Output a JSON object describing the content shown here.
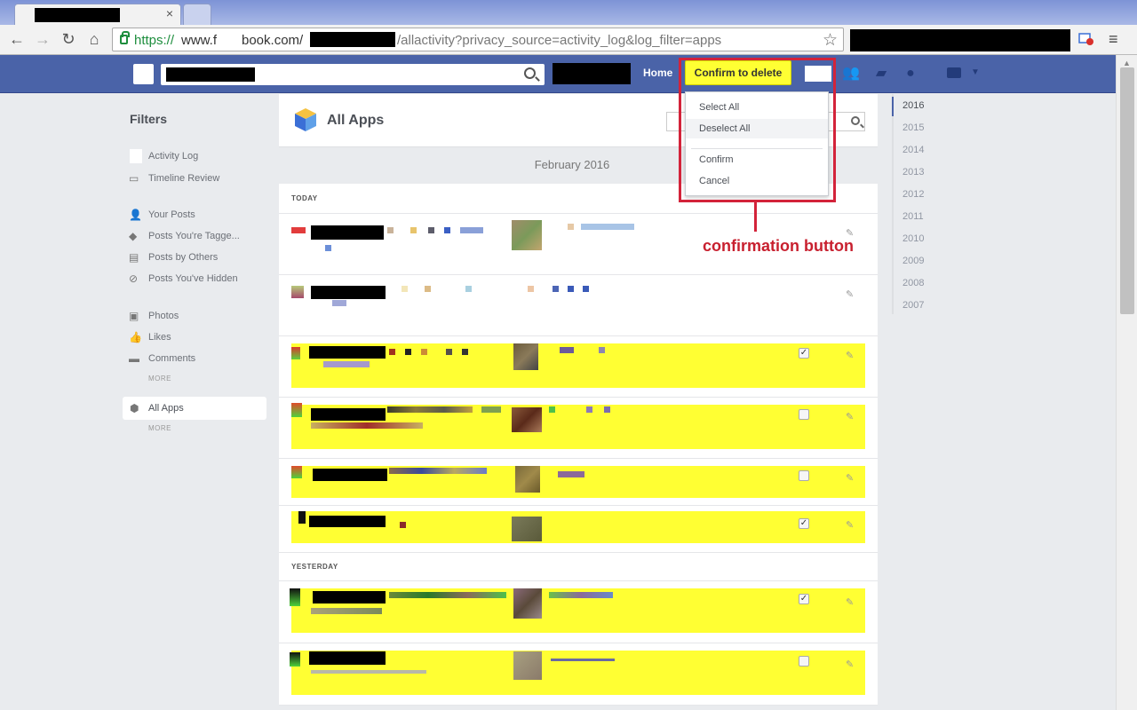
{
  "browser": {
    "url_scheme": "https://",
    "url_host_start": "www.f",
    "url_host_end": "book.com/",
    "url_path": "/allactivity?privacy_source=activity_log&log_filter=apps",
    "tab_close": "×"
  },
  "fb_header": {
    "home_label": "Home",
    "confirm_delete_label": "Confirm to delete"
  },
  "dropdown": {
    "items": [
      "Select All",
      "Deselect All",
      "Confirm",
      "Cancel"
    ]
  },
  "annotation": {
    "label": "confirmation button",
    "color": "#d3233a"
  },
  "filters": {
    "title": "Filters",
    "items": [
      "Activity Log",
      "Timeline Review",
      "Your Posts",
      "Posts You're Tagge...",
      "Posts by Others",
      "Posts You've Hidden",
      "Photos",
      "Likes",
      "Comments",
      "All Apps"
    ],
    "more_label": "MORE"
  },
  "main": {
    "title": "All Apps",
    "month": "February 2016",
    "section_today": "TODAY",
    "section_yesterday": "YESTERDAY"
  },
  "years": [
    "2016",
    "2015",
    "2014",
    "2013",
    "2012",
    "2011",
    "2010",
    "2009",
    "2008",
    "2007"
  ],
  "colors": {
    "fb_blue": "#4a63a8",
    "highlight": "#ffff33"
  }
}
